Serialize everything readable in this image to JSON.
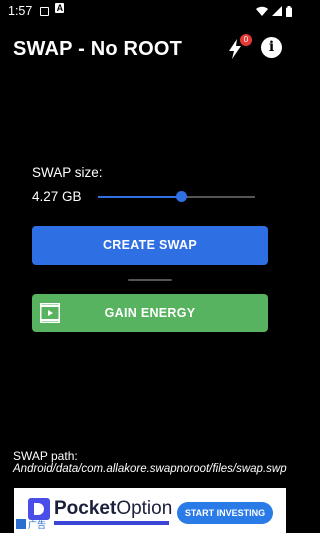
{
  "status_bar": {
    "time": "1:57"
  },
  "header": {
    "title": "SWAP - No ROOT",
    "energy_badge": "0",
    "info_glyph": "i"
  },
  "swap": {
    "size_label": "SWAP size:",
    "size_value": "4.27 GB",
    "slider_fraction": 0.53
  },
  "actions": {
    "create_label": "CREATE SWAP",
    "energy_label": "GAIN ENERGY"
  },
  "path": {
    "label": "SWAP path:",
    "value": "Android/data/com.allakore.swapnoroot/files/swap.swp"
  },
  "ad": {
    "brand_bold": "Pocket",
    "brand_thin": "Option",
    "cta": "START INVESTING",
    "ad_mark": "广告"
  },
  "colors": {
    "accent": "#2f6fe4",
    "energy": "#57b35f",
    "badge": "#e53935",
    "background": "#000000"
  },
  "icons": {
    "energy": "bolt-icon",
    "info": "info-icon",
    "video": "video-icon"
  }
}
